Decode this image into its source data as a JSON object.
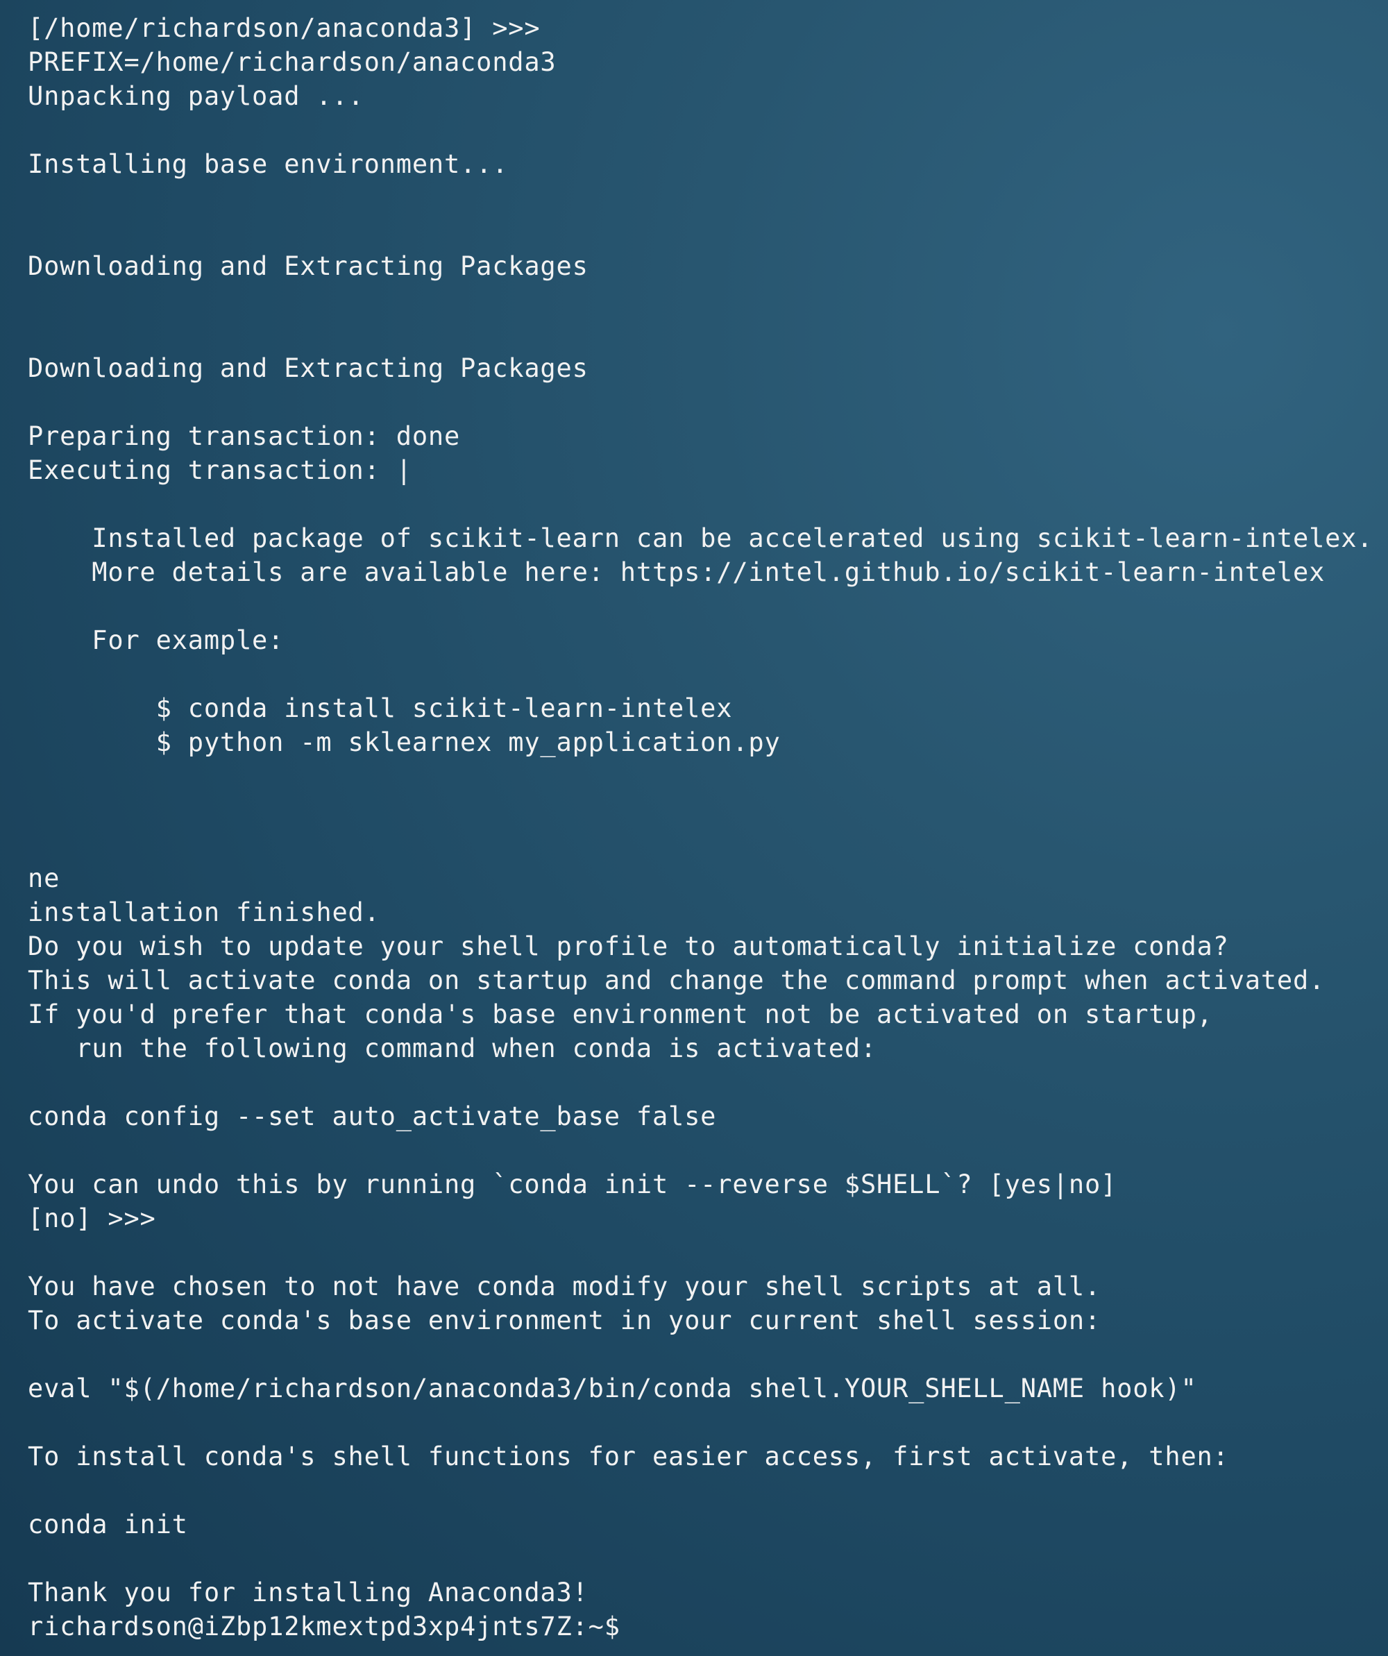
{
  "terminal": {
    "lines": [
      "[/home/richardson/anaconda3] >>>",
      "PREFIX=/home/richardson/anaconda3",
      "Unpacking payload ...",
      "",
      "Installing base environment...",
      "",
      "",
      "Downloading and Extracting Packages",
      "",
      "",
      "Downloading and Extracting Packages",
      "",
      "Preparing transaction: done",
      "Executing transaction: |",
      "",
      "    Installed package of scikit-learn can be accelerated using scikit-learn-intelex.",
      "    More details are available here: https://intel.github.io/scikit-learn-intelex",
      "",
      "    For example:",
      "",
      "        $ conda install scikit-learn-intelex",
      "        $ python -m sklearnex my_application.py",
      "",
      "",
      "",
      "ne",
      "installation finished.",
      "Do you wish to update your shell profile to automatically initialize conda?",
      "This will activate conda on startup and change the command prompt when activated.",
      "If you'd prefer that conda's base environment not be activated on startup,",
      "   run the following command when conda is activated:",
      "",
      "conda config --set auto_activate_base false",
      "",
      "You can undo this by running `conda init --reverse $SHELL`? [yes|no]",
      "[no] >>>",
      "",
      "You have chosen to not have conda modify your shell scripts at all.",
      "To activate conda's base environment in your current shell session:",
      "",
      "eval \"$(/home/richardson/anaconda3/bin/conda shell.YOUR_SHELL_NAME hook)\"",
      "",
      "To install conda's shell functions for easier access, first activate, then:",
      "",
      "conda init",
      "",
      "Thank you for installing Anaconda3!",
      "richardson@iZbp12kmextpd3xp4jnts7Z:~$"
    ]
  }
}
